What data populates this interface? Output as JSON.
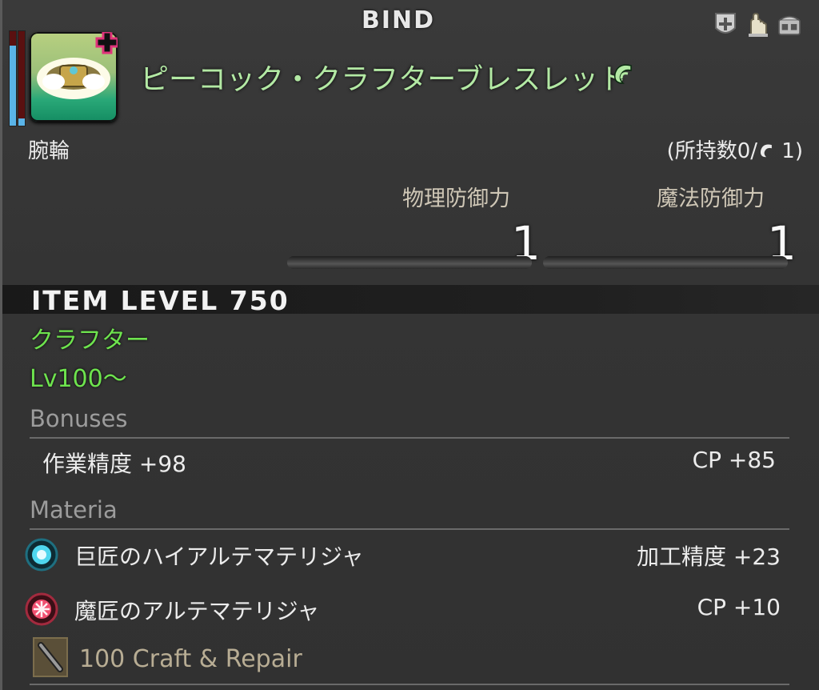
{
  "header": {
    "bind_label": "BIND"
  },
  "top_icons": [
    "shield-plus-icon",
    "hand-icon",
    "chest-icon"
  ],
  "item": {
    "name": "ピーコック・クラフターブレスレット",
    "hq_icon": "hq-icon",
    "category": "腕輪",
    "owned": "(所持数0/",
    "owned_hq_count": " 1)",
    "condition": 0.85,
    "spiritbond": 0.08
  },
  "stats": [
    {
      "label": "物理防御力",
      "value": "1"
    },
    {
      "label": "魔法防御力",
      "value": "1"
    }
  ],
  "item_level": "ITEM LEVEL 750",
  "class": "クラフター",
  "level_req": "Lv100〜",
  "bonuses": {
    "title": "Bonuses",
    "left": "作業精度 +98",
    "right": "CP +85"
  },
  "materia": {
    "title": "Materia",
    "items": [
      {
        "icon": "blue-materia-icon",
        "name": "巨匠のハイアルテマテリジャ",
        "effect": "加工精度 +23"
      },
      {
        "icon": "red-materia-icon",
        "name": "魔匠のアルテマテリジャ",
        "effect": "CP +10"
      }
    ]
  },
  "repair": {
    "icon": "repair-tool-icon",
    "label": "100 Craft & Repair"
  },
  "colors": {
    "item_name": "#b3e9a4",
    "requirement": "#6ee34e",
    "section_title": "#9c9c9c",
    "stat_label": "#cfc7b6"
  }
}
